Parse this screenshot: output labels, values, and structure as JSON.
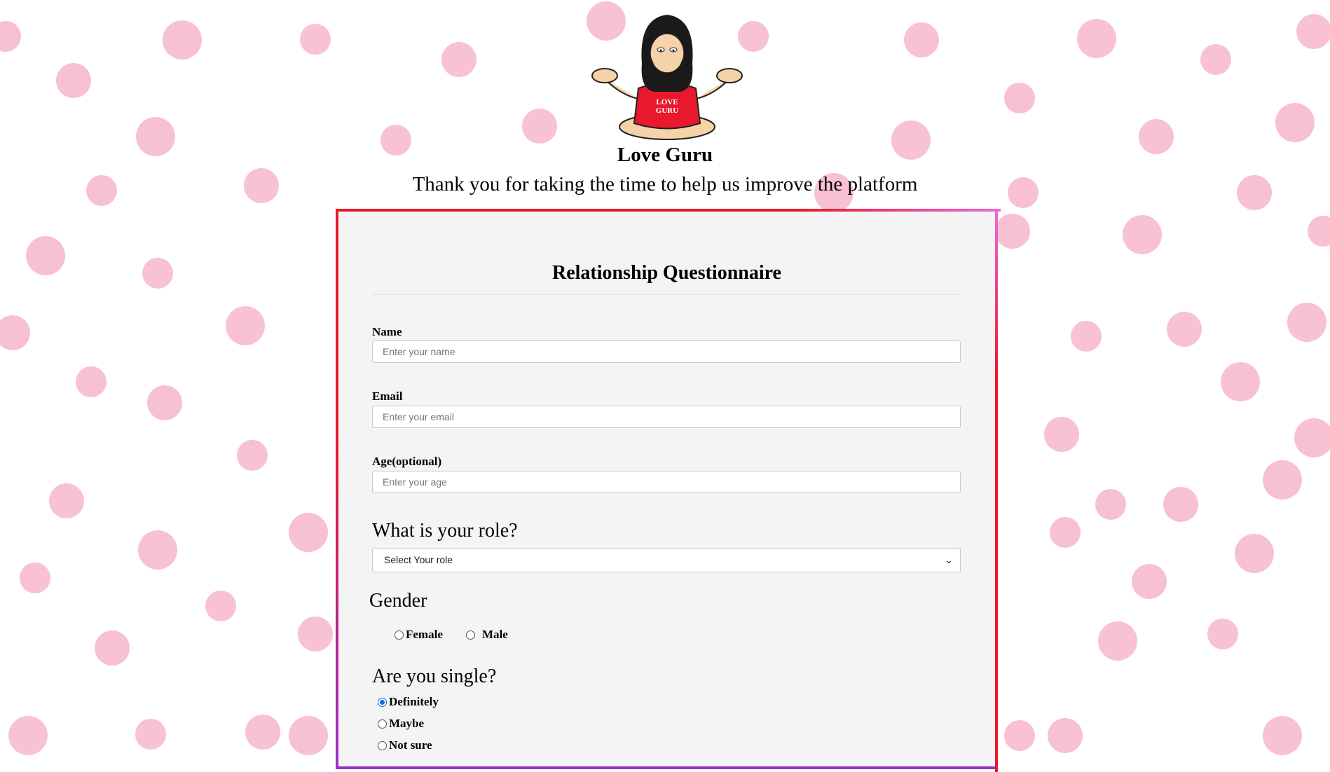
{
  "header": {
    "brand_name": "Love Guru",
    "tagline": "Thank you for taking the time to help us improve the platform",
    "logo_text_line1": "LOVE",
    "logo_text_line2": "GURU"
  },
  "form": {
    "title": "Relationship Questionnaire",
    "name": {
      "label": "Name",
      "placeholder": "Enter your name"
    },
    "email": {
      "label": "Email",
      "placeholder": "Enter your email"
    },
    "age": {
      "label": "Age(optional)",
      "placeholder": "Enter your age"
    },
    "role": {
      "question": "What is your role?",
      "selected": "Select Your role"
    },
    "gender": {
      "question": "Gender",
      "options": [
        {
          "label": "Female",
          "checked": false
        },
        {
          "label": "Male",
          "checked": false
        }
      ]
    },
    "single": {
      "question": "Are you single?",
      "options": [
        {
          "label": "Definitely",
          "checked": true
        },
        {
          "label": "Maybe",
          "checked": false
        },
        {
          "label": "Not sure",
          "checked": false
        }
      ]
    }
  },
  "colors": {
    "background_dots": "#f7b6cc",
    "card_border": "#e8192c",
    "card_border_accent": "#9b2fd1",
    "card_background": "#f4f4f4",
    "radio_checked": "#0a6edc"
  }
}
